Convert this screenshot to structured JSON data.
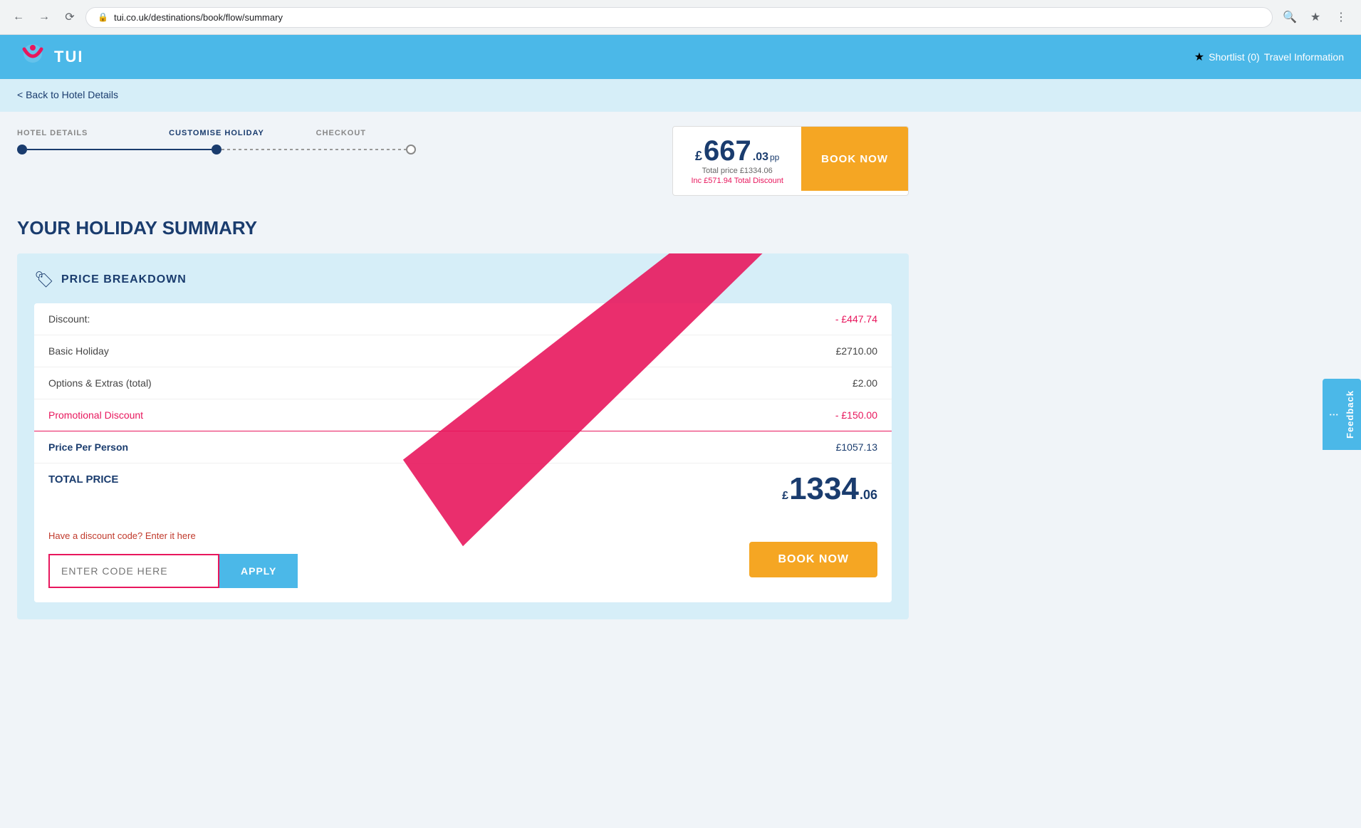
{
  "browser": {
    "url": "tui.co.uk/destinations/book/flow/summary",
    "back_tooltip": "Back",
    "forward_tooltip": "Forward",
    "reload_tooltip": "Reload"
  },
  "header": {
    "logo_text": "TUI",
    "shortlist_label": "Shortlist (0)",
    "travel_info_label": "Travel Information"
  },
  "sub_header": {
    "back_label": "< Back to Hotel Details"
  },
  "progress": {
    "steps": [
      {
        "label": "HOTEL DETAILS",
        "state": "filled"
      },
      {
        "label": "CUSTOMISE HOLIDAY",
        "state": "filled"
      },
      {
        "label": "CHECKOUT",
        "state": "empty"
      }
    ]
  },
  "pricing_header": {
    "price_pound": "£",
    "price_int": "667",
    "price_dec": ".03",
    "price_pp": "pp",
    "total_label": "Total price £1334.06",
    "discount_label": "Inc £571.94 Total Discount",
    "book_now_label": "BOOK NOW"
  },
  "page_title": "YOUR HOLIDAY SUMMARY",
  "price_breakdown": {
    "section_title": "PRICE BREAKDOWN",
    "rows": [
      {
        "label": "Discount:",
        "value": "- £447.74",
        "type": "red"
      },
      {
        "label": "Basic Holiday",
        "value": "£2710.00",
        "type": "normal"
      },
      {
        "label": "Options & Extras (total)",
        "value": "£2.00",
        "type": "normal"
      },
      {
        "label": "Promotional Discount",
        "value": "- £150.00",
        "type": "promotional"
      }
    ],
    "price_per_person_label": "Price Per Person",
    "price_per_person_value": "£1057.13",
    "total_label": "TOTAL PRICE",
    "total_pound": "£",
    "total_int": "1334",
    "total_dec": ".06"
  },
  "discount_code": {
    "label": "Have a discount code? Enter it here",
    "input_placeholder": "ENTER CODE HERE",
    "apply_label": "APPLY"
  },
  "book_now_bottom": {
    "label": "BOOK NOW"
  },
  "feedback": {
    "label": "Feedback"
  },
  "arrow": {
    "color": "#e8175d"
  }
}
